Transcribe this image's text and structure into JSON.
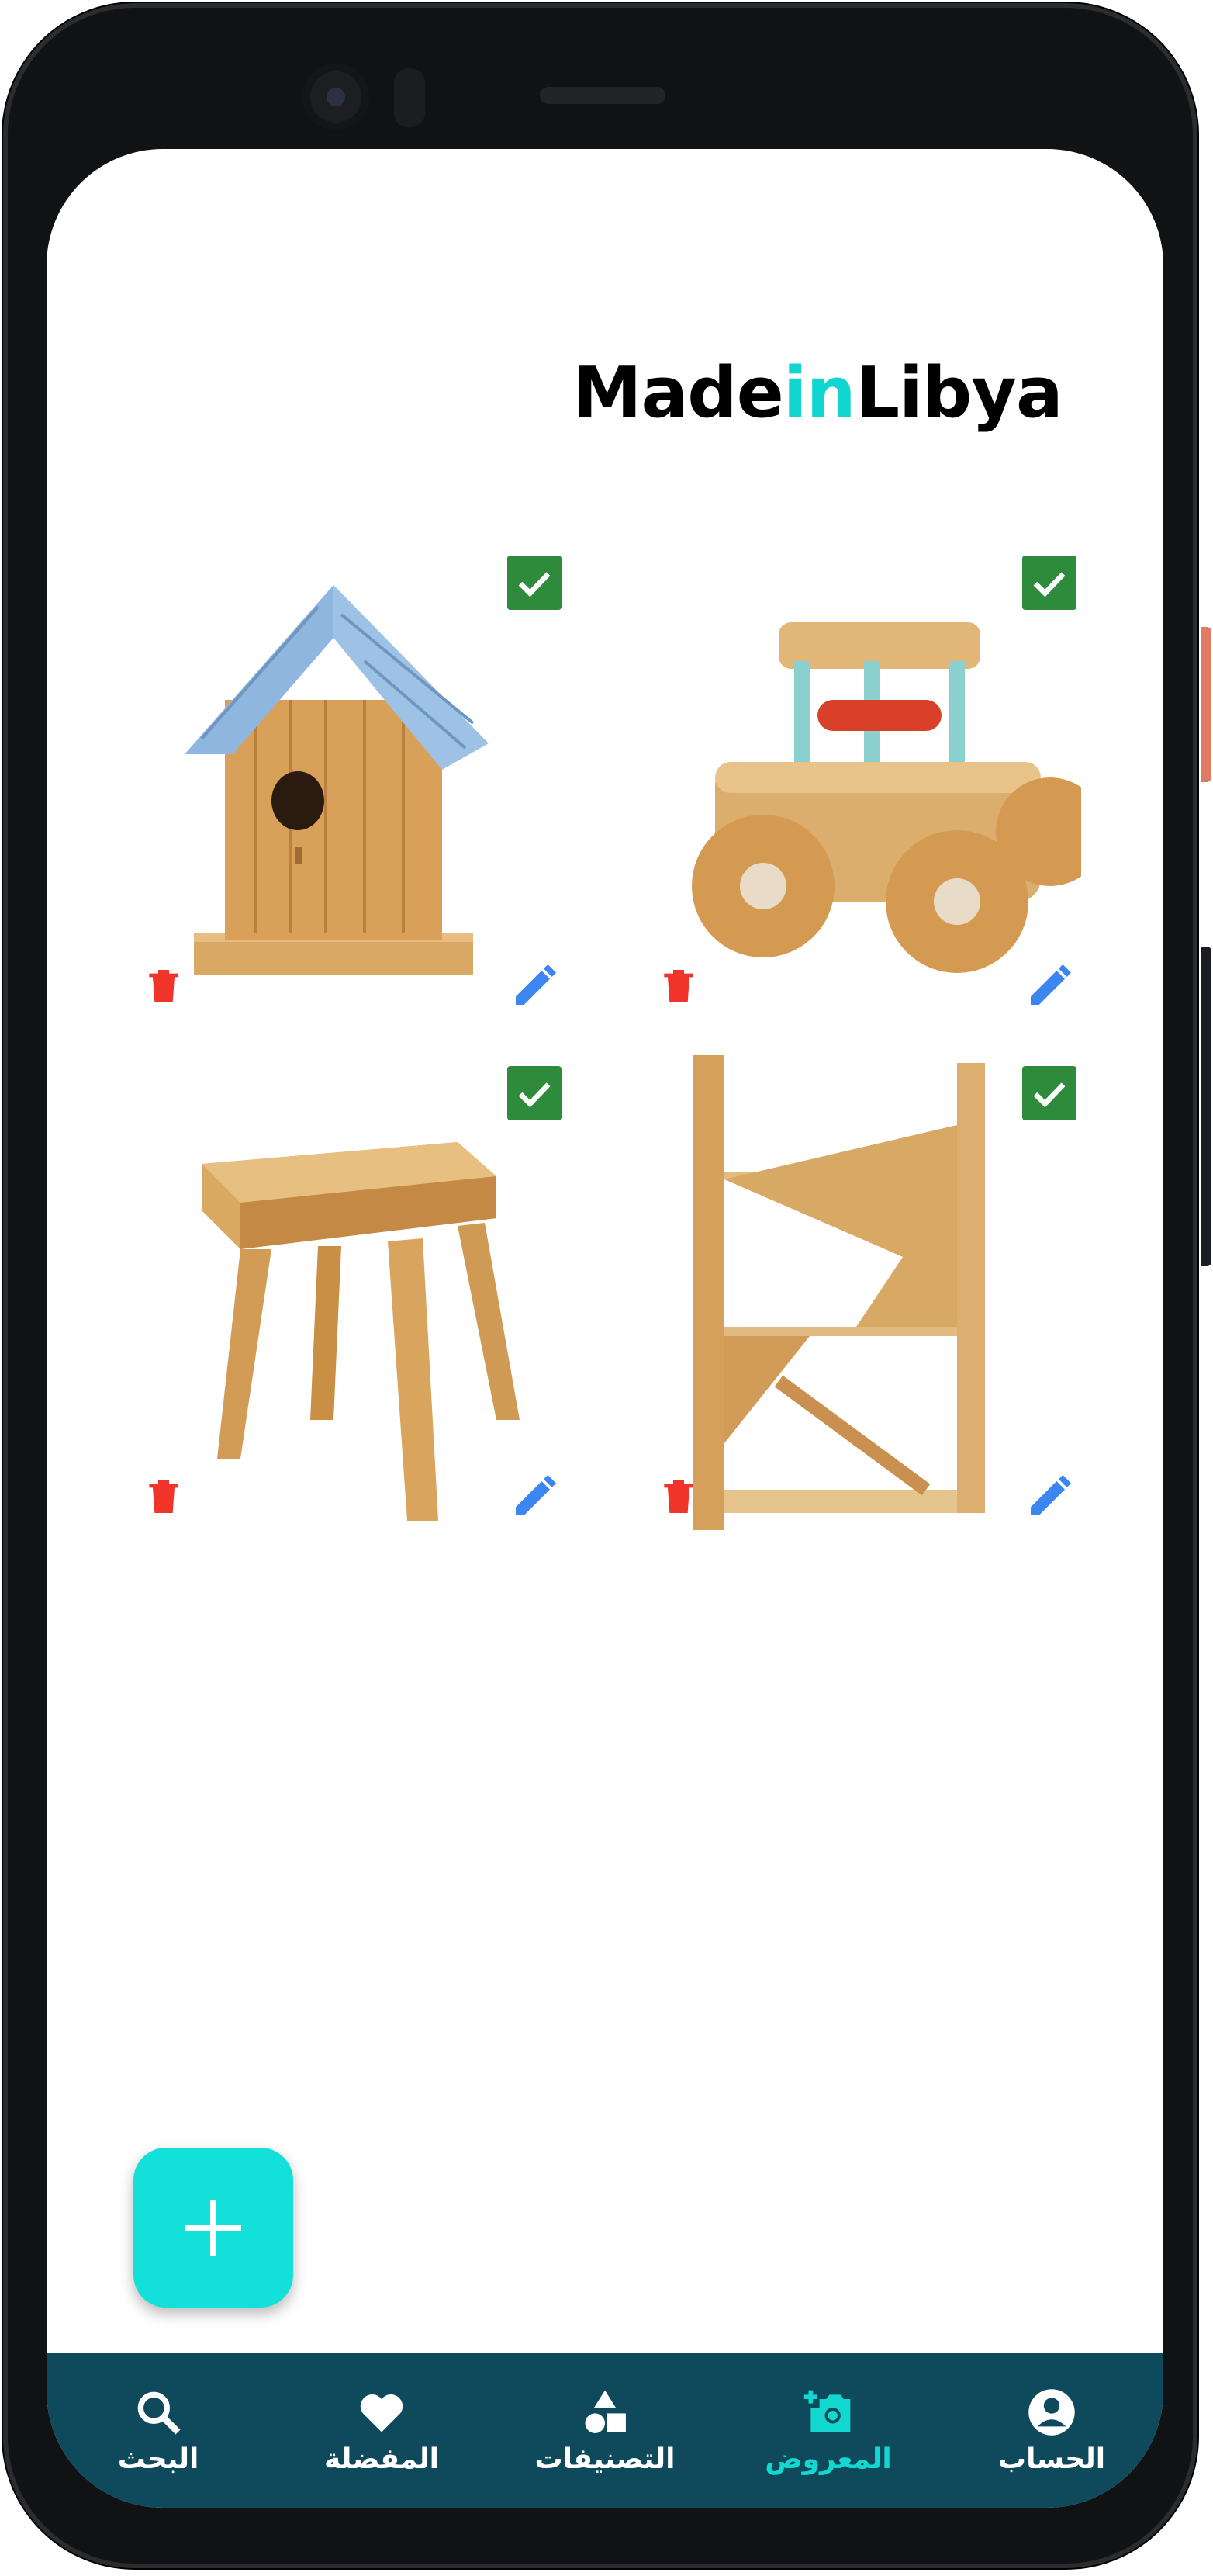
{
  "app": {
    "logo": {
      "part1": "Made",
      "part2": "in",
      "part3": "Libya"
    },
    "accent_color": "#11d6cf",
    "nav_color": "#0e4a5c"
  },
  "products": [
    {
      "name": "birdhouse",
      "checked": true
    },
    {
      "name": "wooden-toy-car",
      "checked": true
    },
    {
      "name": "wooden-stool",
      "checked": true
    },
    {
      "name": "wooden-shelf",
      "checked": true
    }
  ],
  "fab": {
    "icon": "plus-icon"
  },
  "nav": {
    "items": [
      {
        "label": "البحث",
        "icon": "search-icon"
      },
      {
        "label": "المفضلة",
        "icon": "heart-icon"
      },
      {
        "label": "التصنيفات",
        "icon": "category-icon"
      },
      {
        "label": "المعروض",
        "icon": "add-photo-icon",
        "active": true
      },
      {
        "label": "الحساب",
        "icon": "account-icon"
      }
    ]
  }
}
